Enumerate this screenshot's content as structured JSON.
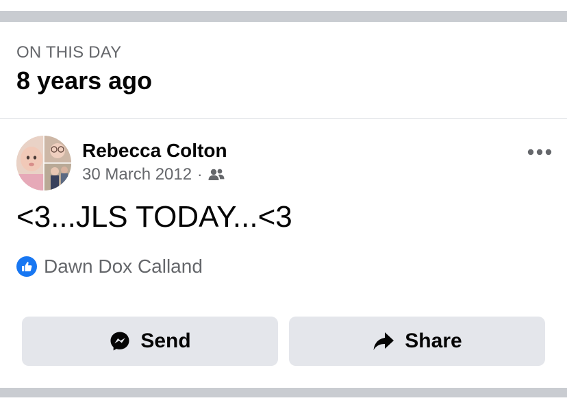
{
  "memories_header": {
    "kicker": "ON THIS DAY",
    "title": "8 years ago"
  },
  "post": {
    "author": "Rebecca Colton",
    "date": "30 March 2012",
    "separator": "·",
    "audience_icon": "friends-icon",
    "more_icon": "more-options-icon",
    "text": "<3...JLS TODAY...<3",
    "reaction_icon": "like-icon",
    "reactor": "Dawn Dox Calland"
  },
  "actions": {
    "send_label": "Send",
    "send_icon": "messenger-icon",
    "share_label": "Share",
    "share_icon": "share-arrow-icon"
  },
  "colors": {
    "like_blue": "#1877f2",
    "button_gray": "#e4e6eb",
    "secondary_text": "#65676b",
    "separator_band": "#c9ccd1"
  }
}
